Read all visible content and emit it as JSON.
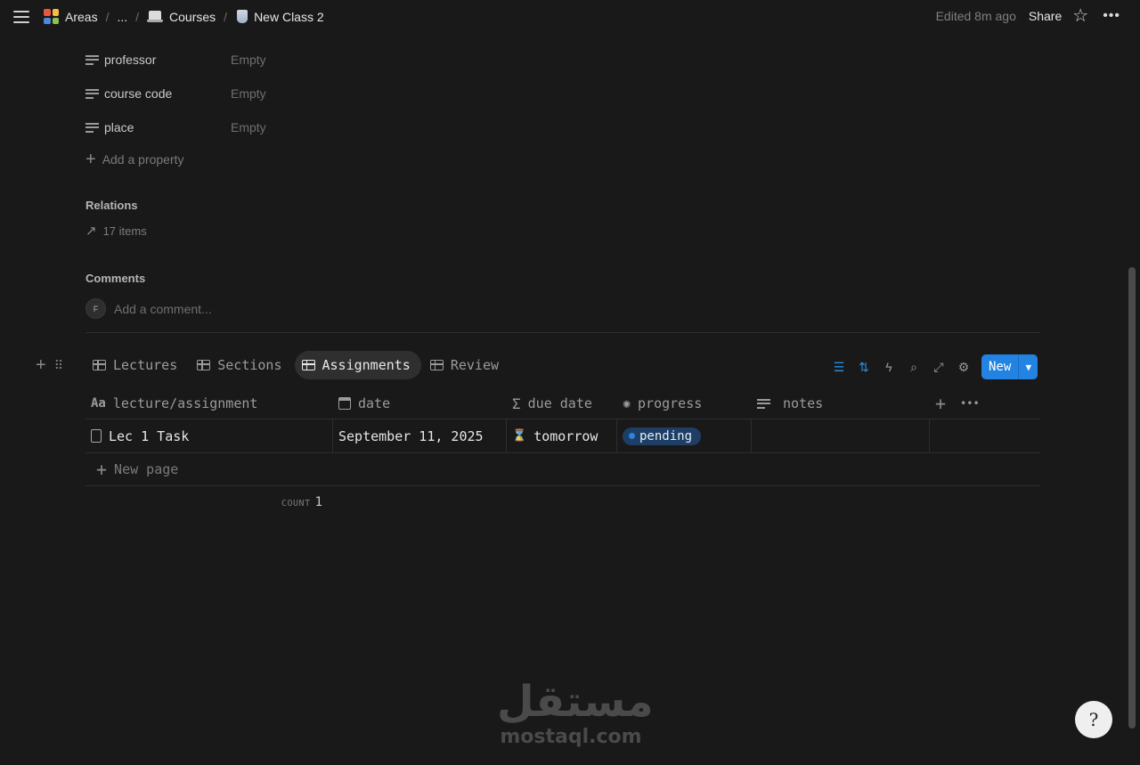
{
  "topbar": {
    "breadcrumbs": [
      {
        "label": "Areas",
        "icon": "colorful-grid-icon"
      },
      {
        "label": "..."
      },
      {
        "label": "Courses",
        "icon": "laptop-icon"
      },
      {
        "label": "New Class 2",
        "icon": "cup-icon"
      }
    ],
    "edited": "Edited 8m ago",
    "share": "Share"
  },
  "properties": [
    {
      "name": "professor",
      "value": "Empty"
    },
    {
      "name": "course code",
      "value": "Empty"
    },
    {
      "name": "place",
      "value": "Empty"
    }
  ],
  "add_property": "Add a property",
  "relations": {
    "title": "Relations",
    "count": "17 items"
  },
  "comments": {
    "title": "Comments",
    "avatar": "F",
    "placeholder": "Add a comment..."
  },
  "views": {
    "tabs": [
      "Lectures",
      "Sections",
      "Assignments",
      "Review"
    ],
    "active": "Assignments",
    "new_label": "New"
  },
  "table": {
    "columns": [
      "lecture/assignment",
      "date",
      "due date",
      "progress",
      "notes"
    ],
    "rows": [
      {
        "title": "Lec 1 Task",
        "date": "September 11, 2025",
        "due": "tomorrow",
        "progress": "pending",
        "notes": ""
      }
    ],
    "new_page": "New page",
    "count_label": "COUNT",
    "count_value": "1"
  },
  "watermark": {
    "arabic": "مستقل",
    "latin": "mostaql.com"
  },
  "help": "?",
  "colors": {
    "accent": "#2383e2",
    "pill_bg": "#1e3e66",
    "background": "#191919"
  }
}
